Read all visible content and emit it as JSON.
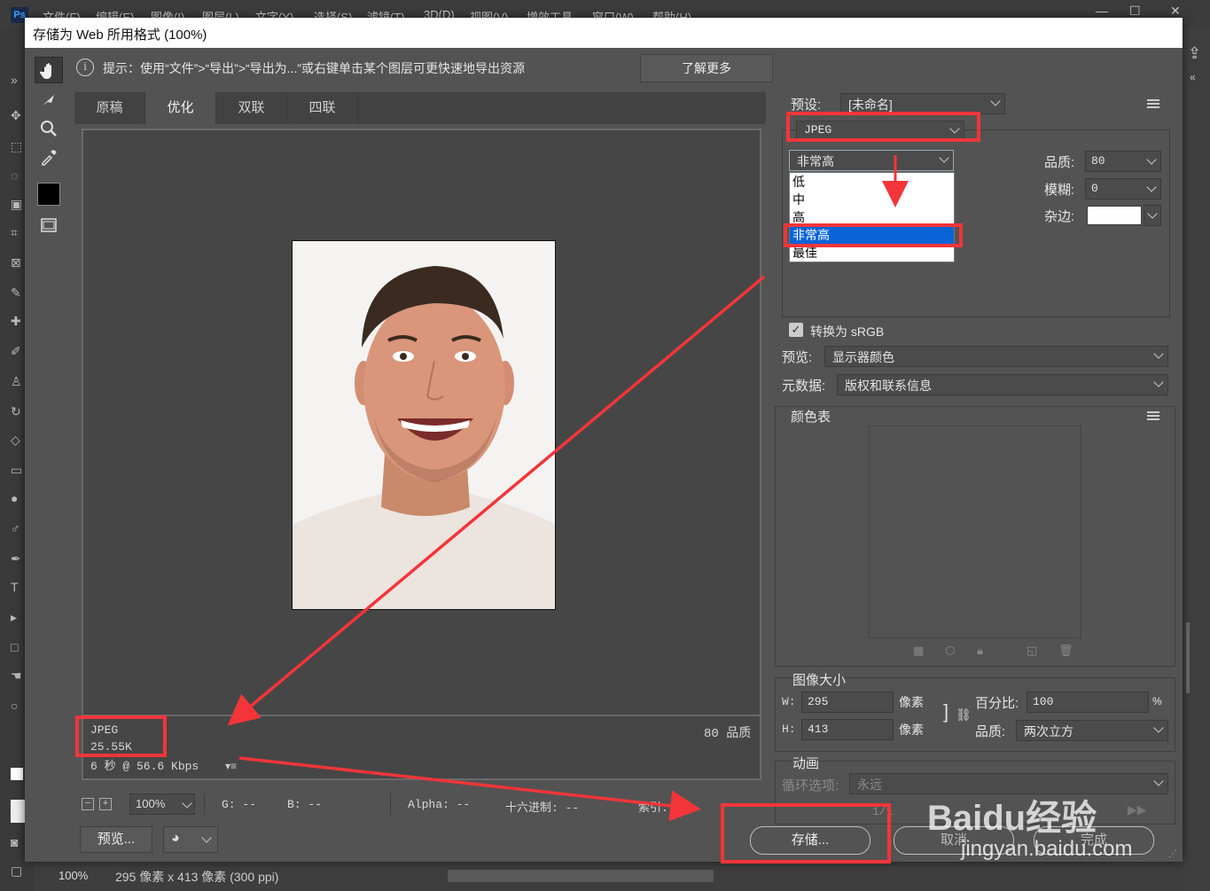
{
  "app": {
    "menu": [
      "文件(F)",
      "编辑(E)",
      "图像(I)",
      "图层(L)",
      "文字(Y)",
      "选择(S)",
      "滤镜(T)",
      "3D(D)",
      "视图(V)",
      "增效工具",
      "窗口(W)",
      "帮助(H)"
    ],
    "status_zoom": "100%",
    "status_docinfo": "295 像素 x 413 像素 (300 ppi)"
  },
  "dialog": {
    "title": "存储为 Web 所用格式 (100%)",
    "info_text": "提示：使用“文件”>“导出”>“导出为...”或右键单击某个图层可更快速地导出资源",
    "learn_more": "了解更多",
    "tabs": [
      "原稿",
      "优化",
      "双联",
      "四联"
    ],
    "active_tab": "优化",
    "preview": {
      "format": "JPEG",
      "size": "25.55K",
      "timing": "6 秒 @ 56.6 Kbps",
      "quality_label": "80 品质"
    },
    "bottom_bar": {
      "zoom": "100%",
      "r_label": "G: --",
      "b_label": "B: --",
      "alpha_label": "Alpha: --",
      "hex_label": "十六进制: --",
      "index_label": "索引: --"
    },
    "buttons": {
      "preview": "预览...",
      "save": "存储...",
      "cancel": "取消",
      "done": "完成"
    },
    "settings": {
      "preset_label": "预设:",
      "preset_value": "[未命名]",
      "format_value": "JPEG",
      "quality_level": "非常高",
      "quality_options": [
        "低",
        "中",
        "高",
        "非常高",
        "最佳"
      ],
      "quality_selected_index": 3,
      "quality_label": "品质:",
      "quality_value": "80",
      "blur_label": "模糊:",
      "blur_value": "0",
      "matte_label": "杂边:",
      "convert_srgb": "转换为 sRGB",
      "convert_srgb_checked": true,
      "preview_label": "预览:",
      "preview_value": "显示器颜色",
      "metadata_label": "元数据:",
      "metadata_value": "版权和联系信息",
      "color_table_label": "颜色表",
      "image_size_label": "图像大小",
      "w_label": "W:",
      "w_value": "295",
      "h_label": "H:",
      "h_value": "413",
      "pixels_unit": "像素",
      "percent_label": "百分比:",
      "percent_value": "100",
      "percent_sign": "%",
      "resample_label": "品质:",
      "resample_value": "两次立方",
      "animation_label": "动画",
      "loop_label": "循环选项:",
      "loop_value": "永远",
      "frame_counter": "1/1"
    }
  },
  "watermark": {
    "brand": "Baidu经验",
    "url": "jingyan.baidu.com"
  },
  "colors": {
    "annotation_red": "#f33539",
    "selection_blue": "#0a64d8"
  }
}
